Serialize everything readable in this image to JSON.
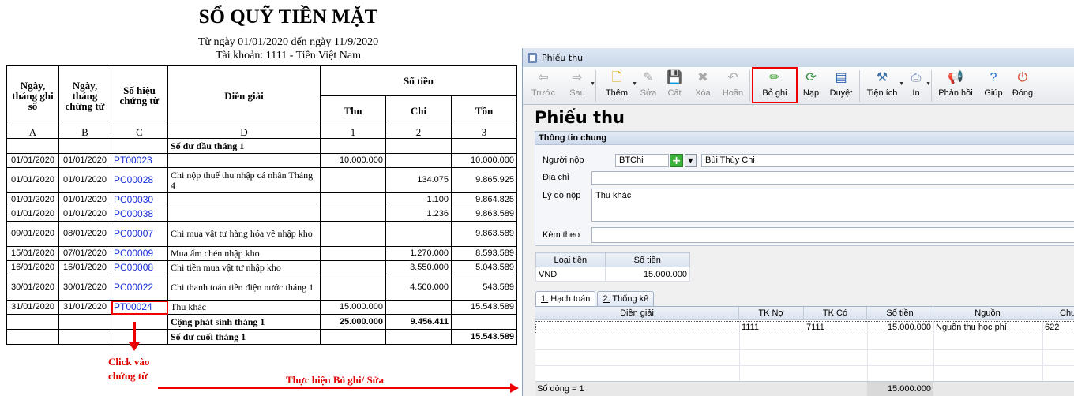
{
  "ledger": {
    "title": "SỔ QUỸ TIỀN MẶT",
    "period": "Từ ngày 01/01/2020 đến ngày 11/9/2020",
    "account": "Tài khoản: 1111 - Tiền Việt Nam",
    "headers": {
      "col_a": "Ngày, tháng ghi sổ",
      "col_b": "Ngày, tháng chứng từ",
      "col_c": "Số hiệu chứng từ",
      "col_d": "Diễn giải",
      "money": "Số tiền",
      "thu": "Thu",
      "chi": "Chi",
      "ton": "Tồn"
    },
    "letters": [
      "A",
      "B",
      "C",
      "D",
      "1",
      "2",
      "3"
    ],
    "opening_label": "Số dư đầu tháng 1",
    "rows": [
      {
        "post": "01/01/2020",
        "doc_date": "01/01/2020",
        "doc_no": "PT00023",
        "desc": "",
        "thu": "10.000.000",
        "chi": "",
        "ton": "10.000.000"
      },
      {
        "post": "01/01/2020",
        "doc_date": "01/01/2020",
        "doc_no": "PC00028",
        "desc": "Chi nộp thuế thu nhập cá nhân Tháng 4",
        "thu": "",
        "chi": "134.075",
        "ton": "9.865.925"
      },
      {
        "post": "01/01/2020",
        "doc_date": "01/01/2020",
        "doc_no": "PC00030",
        "desc": "",
        "thu": "",
        "chi": "1.100",
        "ton": "9.864.825"
      },
      {
        "post": "01/01/2020",
        "doc_date": "01/01/2020",
        "doc_no": "PC00038",
        "desc": "",
        "thu": "",
        "chi": "1.236",
        "ton": "9.863.589"
      },
      {
        "post": "09/01/2020",
        "doc_date": "08/01/2020",
        "doc_no": "PC00007",
        "desc": "Chi mua vật tư hàng hóa về nhập kho",
        "thu": "",
        "chi": "",
        "ton": "9.863.589"
      },
      {
        "post": "15/01/2020",
        "doc_date": "07/01/2020",
        "doc_no": "PC00009",
        "desc": "Mua ấm chén nhập kho",
        "thu": "",
        "chi": "1.270.000",
        "ton": "8.593.589"
      },
      {
        "post": "16/01/2020",
        "doc_date": "16/01/2020",
        "doc_no": "PC00008",
        "desc": "Chi tiền mua vật tư nhập kho",
        "thu": "",
        "chi": "3.550.000",
        "ton": "5.043.589"
      },
      {
        "post": "30/01/2020",
        "doc_date": "30/01/2020",
        "doc_no": "PC00022",
        "desc": "Chi thanh toán tiền điện nước tháng 1",
        "thu": "",
        "chi": "4.500.000",
        "ton": "543.589"
      },
      {
        "post": "31/01/2020",
        "doc_date": "31/01/2020",
        "doc_no": "PT00024",
        "desc": "Thu khác",
        "thu": "15.000.000",
        "chi": "",
        "ton": "15.543.589"
      }
    ],
    "total_label": "Cộng phát sinh tháng 1",
    "total_thu": "25.000.000",
    "total_chi": "9.456.411",
    "closing_label": "Số dư cuối tháng 1",
    "closing_ton": "15.543.589"
  },
  "annotations": {
    "click_line1": "Click vào",
    "click_line2": "chứng từ",
    "action": "Thực hiện Bỏ ghi/ Sửa",
    "accent_color": "#e00000"
  },
  "window": {
    "title": "Phiếu thu",
    "toolbar": [
      {
        "label": "Trước",
        "icon": "arrow-left-icon",
        "disabled": true
      },
      {
        "label": "Sau",
        "icon": "arrow-right-icon",
        "disabled": true
      },
      {
        "label": "Thêm",
        "icon": "add-document-icon",
        "disabled": false
      },
      {
        "label": "Sửa",
        "icon": "edit-icon",
        "disabled": true
      },
      {
        "label": "Cất",
        "icon": "save-icon",
        "disabled": true
      },
      {
        "label": "Xóa",
        "icon": "delete-icon",
        "disabled": true
      },
      {
        "label": "Hoãn",
        "icon": "undo-icon",
        "disabled": true
      },
      {
        "label": "Bỏ ghi",
        "icon": "unpost-icon",
        "disabled": false
      },
      {
        "label": "Nạp",
        "icon": "refresh-icon",
        "disabled": false
      },
      {
        "label": "Duyệt",
        "icon": "browse-icon",
        "disabled": false
      },
      {
        "label": "Tiện ích",
        "icon": "tools-icon",
        "disabled": false
      },
      {
        "label": "In",
        "icon": "print-icon",
        "disabled": false
      },
      {
        "label": "Phản hồi",
        "icon": "feedback-icon",
        "disabled": false
      },
      {
        "label": "Giúp",
        "icon": "help-icon",
        "disabled": false
      },
      {
        "label": "Đóng",
        "icon": "close-icon",
        "disabled": false
      }
    ],
    "form_title": "Phiếu thu",
    "group_title": "Thông tin chung",
    "payer_label": "Người nộp",
    "payer_code": "BTChi",
    "payer_name": "Bùi Thùy Chi",
    "address_label": "Địa chỉ",
    "address_value": "",
    "reason_label": "Lý do nộp",
    "reason_value": "Thu khác",
    "attach_label": "Kèm theo",
    "attach_value": "",
    "currency_headers": [
      "Loại tiền",
      "Số tiền"
    ],
    "currency_row": [
      "VND",
      "15.000.000"
    ],
    "tabs": [
      {
        "num": "1.",
        "label": " Hạch toán"
      },
      {
        "num": "2.",
        "label": " Thống kê"
      }
    ],
    "grid_headers": [
      "Diễn giải",
      "TK Nợ",
      "TK Có",
      "Số tiền",
      "Nguồn",
      "Chư"
    ],
    "grid_row": [
      "",
      "1111",
      "7111",
      "15.000.000",
      "Nguồn thu học phí",
      "622"
    ],
    "row_count": "Số dòng = 1",
    "grid_total": "15.000.000"
  }
}
